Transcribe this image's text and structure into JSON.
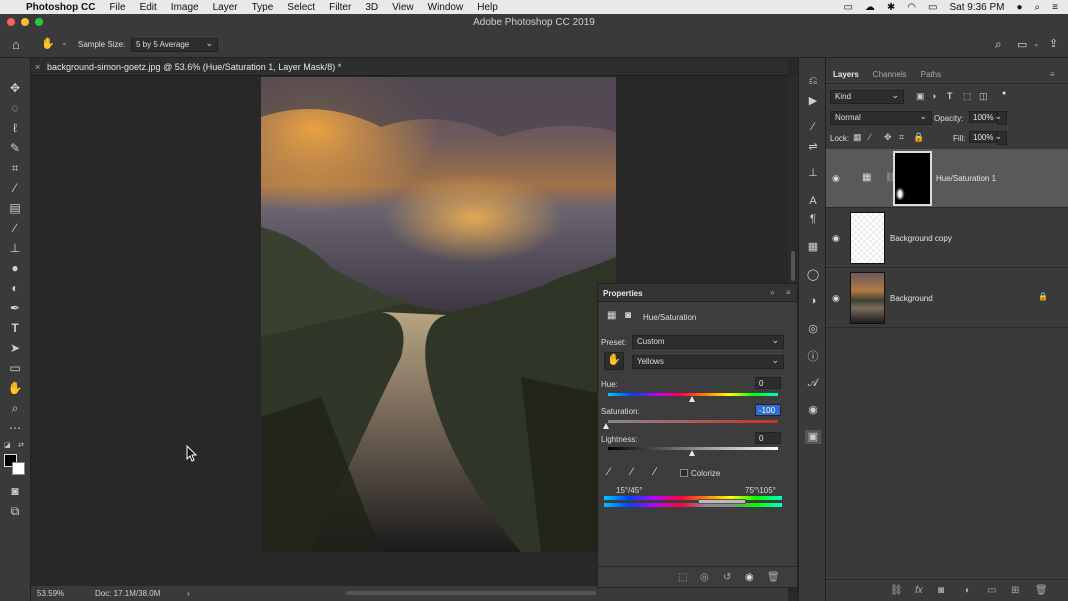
{
  "menubar": {
    "apple": "",
    "app_name": "Photoshop CC",
    "menus": [
      "File",
      "Edit",
      "Image",
      "Layer",
      "Type",
      "Select",
      "Filter",
      "3D",
      "View",
      "Window",
      "Help"
    ],
    "clock": "Sat 9:36 PM"
  },
  "window": {
    "title": "Adobe Photoshop CC 2019"
  },
  "options": {
    "sample_size_label": "Sample Size:",
    "sample_size_value": "5 by 5 Average"
  },
  "document": {
    "tab_title": "background-simon-goetz.jpg @ 53.6% (Hue/Saturation 1, Layer Mask/8) *",
    "close": "×"
  },
  "status": {
    "zoom": "53.59%",
    "doc": "Doc: 17.1M/38.0M",
    "arrow": "›"
  },
  "properties": {
    "title": "Properties",
    "adjustment": "Hue/Saturation",
    "preset_label": "Preset:",
    "preset_value": "Custom",
    "channel_value": "Yellows",
    "hue_label": "Hue:",
    "hue_value": "0",
    "saturation_label": "Saturation:",
    "saturation_value": "-100",
    "lightness_label": "Lightness:",
    "lightness_value": "0",
    "colorize_label": "Colorize",
    "range_left": "15°/45°",
    "range_right": "75°\\105°"
  },
  "layers_panel": {
    "tabs": [
      "Layers",
      "Channels",
      "Paths"
    ],
    "filter_kind": "Kind",
    "blend_mode": "Normal",
    "opacity_label": "Opacity:",
    "opacity_value": "100%",
    "lock_label": "Lock:",
    "fill_label": "Fill:",
    "fill_value": "100%",
    "layers": [
      {
        "name": "Hue/Saturation 1",
        "selected": true
      },
      {
        "name": "Background copy",
        "selected": false
      },
      {
        "name": "Background",
        "selected": false
      }
    ]
  },
  "colors": {
    "accent_highlight": "#2f6dd0",
    "panel_bg": "#3a3a3a",
    "canvas_bg": "#282828"
  }
}
